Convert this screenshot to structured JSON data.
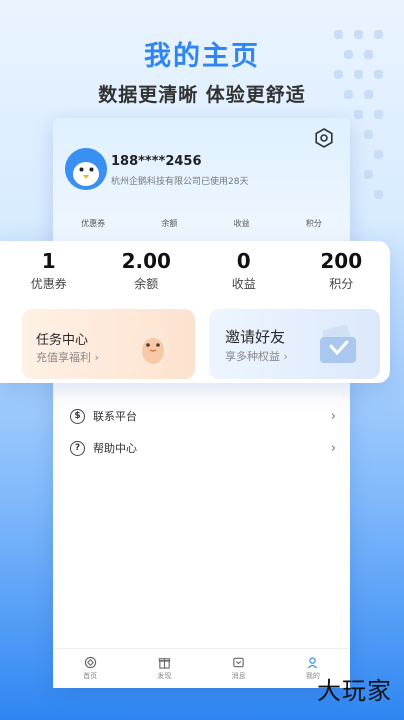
{
  "promo": {
    "headline": "我的主页",
    "subline": "数据更清晰 体验更舒适"
  },
  "profile": {
    "phone": "188****2456",
    "company_line": "杭州企鹅科技有限公司已使用28天"
  },
  "mini_stats": [
    "优惠券",
    "余额",
    "收益",
    "积分"
  ],
  "stats": [
    {
      "value": "1",
      "label": "优惠券"
    },
    {
      "value": "2.00",
      "label": "余额"
    },
    {
      "value": "0",
      "label": "收益"
    },
    {
      "value": "200",
      "label": "积分"
    }
  ],
  "cards": {
    "task": {
      "title": "任务中心",
      "subtitle": "充值享福利 ›"
    },
    "invite": {
      "title": "邀请好友",
      "subtitle": "享多种权益 ›"
    }
  },
  "menu": [
    {
      "label": "联系平台",
      "icon": "link-icon"
    },
    {
      "label": "帮助中心",
      "icon": "help-icon"
    }
  ],
  "tabs": [
    {
      "label": "首页",
      "icon": "home-icon"
    },
    {
      "label": "发现",
      "icon": "gift-icon"
    },
    {
      "label": "消息",
      "icon": "message-icon"
    },
    {
      "label": "我的",
      "icon": "user-icon"
    }
  ],
  "watermark": "大玩家",
  "colors": {
    "accent": "#2f86f3",
    "task_card": "#fde2cf",
    "invite_card": "#dce9fb"
  }
}
